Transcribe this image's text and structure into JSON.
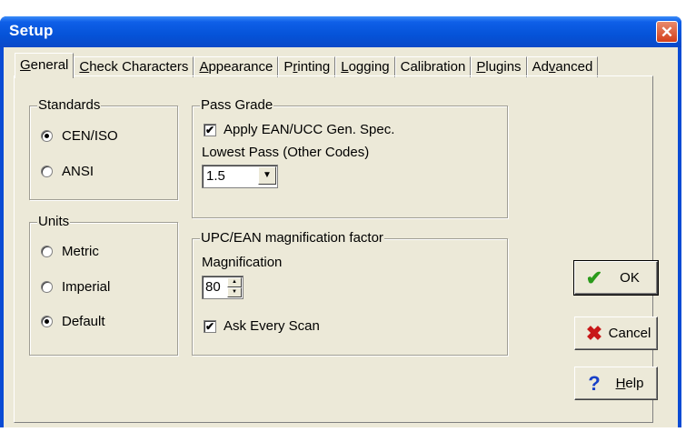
{
  "window": {
    "title": "Setup",
    "close_glyph": "✕",
    "accent": "#0553d8"
  },
  "tabs": [
    {
      "label": "General",
      "mnemonic": "G",
      "rest": "eneral",
      "active": true
    },
    {
      "label": "Check Characters",
      "mnemonic": "C",
      "rest": "heck Characters",
      "active": false
    },
    {
      "label": "Appearance",
      "mnemonic": "A",
      "rest": "ppearance",
      "active": false
    },
    {
      "label": "Printing",
      "pre": "P",
      "mnemonic": "r",
      "rest": "inting",
      "active": false
    },
    {
      "label": "Logging",
      "mnemonic": "L",
      "rest": "ogging",
      "active": false
    },
    {
      "label": "Calibration",
      "active": false
    },
    {
      "label": "Plugins",
      "mnemonic": "P",
      "rest": "lugins",
      "active": false
    },
    {
      "label": "Advanced",
      "pre": "Ad",
      "mnemonic": "v",
      "rest": "anced",
      "active": false
    }
  ],
  "standards": {
    "title": "Standards",
    "options": [
      {
        "label": "CEN/ISO",
        "selected": true
      },
      {
        "label": "ANSI",
        "selected": false
      }
    ]
  },
  "units": {
    "title": "Units",
    "options": [
      {
        "label": "Metric",
        "selected": false
      },
      {
        "label": "Imperial",
        "selected": false
      },
      {
        "label": "Default",
        "selected": true
      }
    ]
  },
  "pass_grade": {
    "title": "Pass Grade",
    "apply_label": "Apply EAN/UCC Gen. Spec.",
    "apply_checked": true,
    "lowest_pass_label": "Lowest Pass (Other Codes)",
    "lowest_pass_value": "1.5"
  },
  "magnification": {
    "title": "UPC/EAN magnification factor",
    "label": "Magnification",
    "value": "80",
    "ask_label": "Ask Every Scan",
    "ask_checked": true
  },
  "buttons": {
    "ok": {
      "label": "OK",
      "icon": "checkmark-icon",
      "color": "#2a9a1a"
    },
    "cancel": {
      "label": "Cancel",
      "icon": "x-icon",
      "color": "#c81818"
    },
    "help": {
      "pre": "",
      "mnemonic": "H",
      "rest": "elp",
      "label": "Help",
      "icon": "question-icon",
      "color": "#1840c8"
    }
  }
}
